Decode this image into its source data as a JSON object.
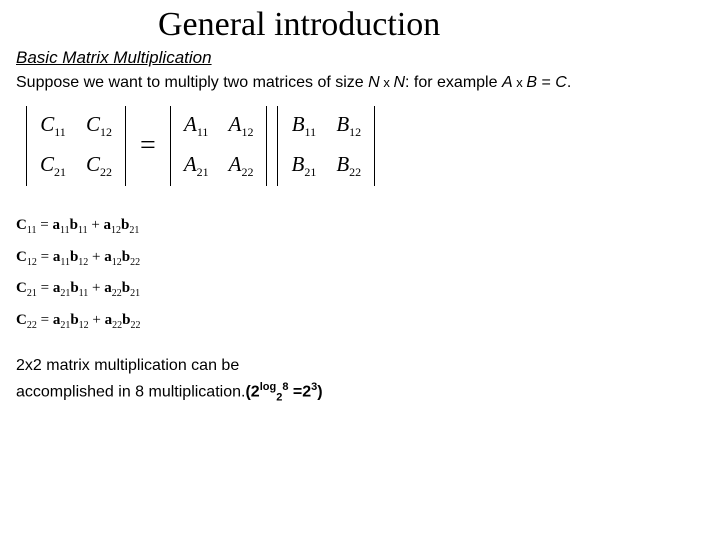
{
  "title": "General introduction",
  "subtitle": "Basic Matrix Multiplication",
  "intro_pre": "Suppose we want to multiply two matrices of size ",
  "intro_N1": "N",
  "intro_x1": " x ",
  "intro_N2": "N",
  "intro_mid": ": for example ",
  "intro_A": "A",
  "intro_x2": " x ",
  "intro_B": "B",
  "intro_eq": " = ",
  "intro_C": "C",
  "intro_end": ".",
  "matC": {
    "r1c1_b": "C",
    "r1c1_s": "11",
    "r1c2_b": "C",
    "r1c2_s": "12",
    "r2c1_b": "C",
    "r2c1_s": "21",
    "r2c2_b": "C",
    "r2c2_s": "22"
  },
  "equals": "=",
  "matA": {
    "r1c1_b": "A",
    "r1c1_s": "11",
    "r1c2_b": "A",
    "r1c2_s": "12",
    "r2c1_b": "A",
    "r2c1_s": "21",
    "r2c2_b": "A",
    "r2c2_s": "22"
  },
  "matB": {
    "r1c1_b": "B",
    "r1c1_s": "11",
    "r1c2_b": "B",
    "r1c2_s": "12",
    "r2c1_b": "B",
    "r2c1_s": "21",
    "r2c2_b": "B",
    "r2c2_s": "22"
  },
  "eq1": {
    "C": "C",
    "Cs": "11",
    "eq": " = ",
    "a1": "a",
    "a1s": "11",
    "b1": "b",
    "b1s": "11",
    "plus": " + ",
    "a2": "a",
    "a2s": "12",
    "b2": "b",
    "b2s": "21"
  },
  "eq2": {
    "C": "C",
    "Cs": "12",
    "eq": " = ",
    "a1": "a",
    "a1s": "11",
    "b1": "b",
    "b1s": "12",
    "plus": " + ",
    "a2": "a",
    "a2s": "12",
    "b2": "b",
    "b2s": "22"
  },
  "eq3": {
    "C": "C",
    "Cs": "21",
    "eq": " = ",
    "a1": "a",
    "a1s": "21",
    "b1": "b",
    "b1s": "11",
    "plus": " + ",
    "a2": "a",
    "a2s": "22",
    "b2": "b",
    "b2s": "21"
  },
  "eq4": {
    "C": "C",
    "Cs": "22",
    "eq": " = ",
    "a1": "a",
    "a1s": "21",
    "b1": "b",
    "b1s": "12",
    "plus": " + ",
    "a2": "a",
    "a2s": "22",
    "b2": "b",
    "b2s": "22"
  },
  "foot_l1": "2x2 matrix multiplication can be",
  "foot_l2a": "accomplished in  8 multiplication.",
  "foot_b1": "(2",
  "foot_sup1": "log",
  "foot_sub1": "2",
  "foot_sup2": "8",
  "foot_b2": " =2",
  "foot_sup3": "3",
  "foot_b3": ")"
}
